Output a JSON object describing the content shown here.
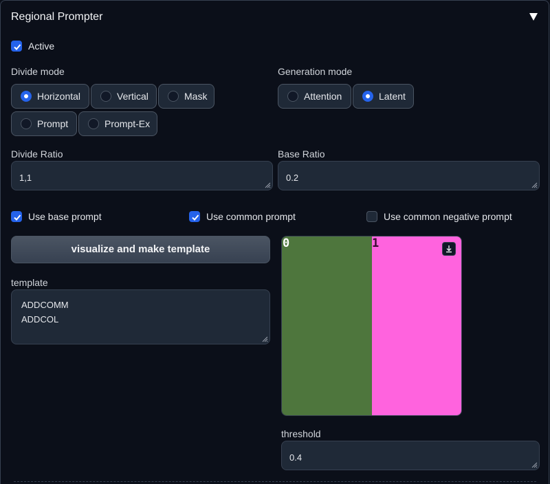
{
  "panel": {
    "title": "Regional Prompter"
  },
  "active": {
    "label": "Active",
    "checked": true
  },
  "divide_mode": {
    "label": "Divide mode",
    "options": [
      "Horizontal",
      "Vertical",
      "Mask",
      "Prompt",
      "Prompt-Ex"
    ],
    "selected": "Horizontal"
  },
  "generation_mode": {
    "label": "Generation mode",
    "options": [
      "Attention",
      "Latent"
    ],
    "selected": "Latent"
  },
  "divide_ratio": {
    "label": "Divide Ratio",
    "value": "1,1"
  },
  "base_ratio": {
    "label": "Base Ratio",
    "value": "0.2"
  },
  "checkboxes": [
    {
      "label": "Use base prompt",
      "checked": true
    },
    {
      "label": "Use common prompt",
      "checked": true
    },
    {
      "label": "Use common negative prompt",
      "checked": false
    }
  ],
  "visualize_button": "visualize and make template",
  "template": {
    "label": "template",
    "lines": [
      "ADDCOMM",
      "ADDCOL"
    ]
  },
  "preview": {
    "regions": [
      {
        "label": "0",
        "color": "#4e763d"
      },
      {
        "label": "1",
        "color": "#ff63de"
      }
    ],
    "download_icon": "download-icon"
  },
  "threshold": {
    "label": "threshold",
    "value": "0.4"
  },
  "colors": {
    "accent": "#2563eb",
    "background": "#0b0f19",
    "input": "#1f2937"
  }
}
